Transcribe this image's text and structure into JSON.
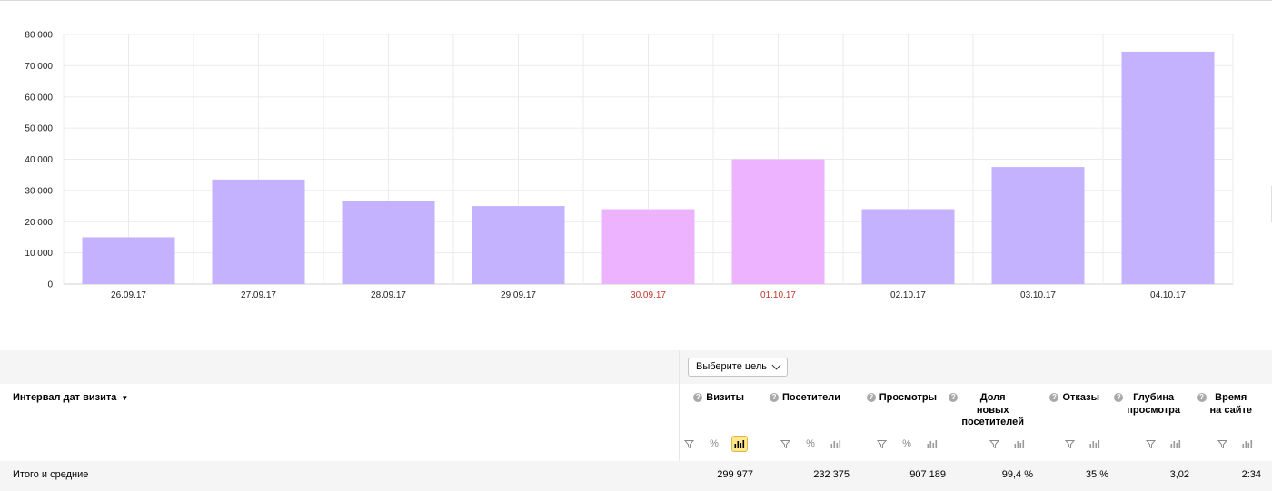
{
  "chart_data": {
    "type": "bar",
    "categories": [
      "26.09.17",
      "27.09.17",
      "28.09.17",
      "29.09.17",
      "30.09.17",
      "01.10.17",
      "02.10.17",
      "03.10.17",
      "04.10.17"
    ],
    "values": [
      15000,
      33500,
      26500,
      25000,
      24000,
      40000,
      24000,
      37500,
      74500
    ],
    "weekend": [
      false,
      false,
      false,
      false,
      true,
      true,
      false,
      false,
      false
    ],
    "y_ticks": [
      "0",
      "10 000",
      "20 000",
      "30 000",
      "40 000",
      "50 000",
      "60 000",
      "70 000",
      "80 000"
    ],
    "ylim": [
      0,
      80000
    ],
    "grid": true,
    "colors": {
      "weekday": "#c5b2ff",
      "weekend": "#edb3ff",
      "weekend_label": "#c0392b",
      "grid": "#ebebeb"
    }
  },
  "goal_selector": {
    "label": "Выберите цель"
  },
  "table": {
    "dimension_header": "Интервал дат визита",
    "metrics": [
      {
        "label_lines": [
          "Визиты"
        ]
      },
      {
        "label_lines": [
          "Посетители"
        ]
      },
      {
        "label_lines": [
          "Просмотры"
        ]
      },
      {
        "label_lines": [
          "Доля",
          "новых",
          "посетителей"
        ]
      },
      {
        "label_lines": [
          "Отказы"
        ]
      },
      {
        "label_lines": [
          "Глубина",
          "просмотра"
        ]
      },
      {
        "label_lines": [
          "Время",
          "на сайте"
        ]
      }
    ],
    "totals_label": "Итого и средние",
    "totals": [
      "299 977",
      "232 375",
      "907 189",
      "99,4 %",
      "35 %",
      "3,02",
      "2:34"
    ]
  },
  "icons": [
    "filter-icon",
    "percent-icon",
    "bar-chart-icon",
    "question-icon",
    "caret-down-icon",
    "chevron-down-icon"
  ]
}
